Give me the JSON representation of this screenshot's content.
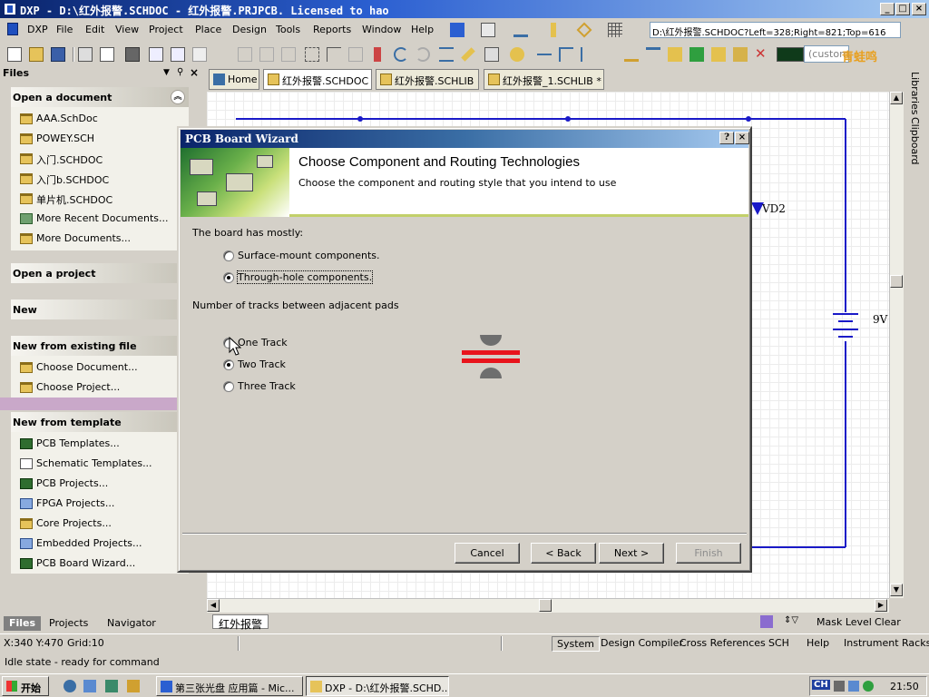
{
  "window": {
    "title": "DXP - D:\\红外报警.SCHDOC - 红外报警.PRJPCB. Licensed to hao",
    "minimize": "_",
    "maximize": "□",
    "close": "×"
  },
  "menu": {
    "items": [
      {
        "label": "DXP",
        "key": "DXP"
      },
      {
        "label": "File",
        "key": "File"
      },
      {
        "label": "Edit",
        "key": "Edit"
      },
      {
        "label": "View",
        "key": "View"
      },
      {
        "label": "Project",
        "key": "Project"
      },
      {
        "label": "Place",
        "key": "Place"
      },
      {
        "label": "Design",
        "key": "Design"
      },
      {
        "label": "Tools",
        "key": "Tools"
      },
      {
        "label": "Reports",
        "key": "Reports"
      },
      {
        "label": "Window",
        "key": "Window"
      },
      {
        "label": "Help",
        "key": "Help"
      }
    ]
  },
  "toolbar": {
    "path_value": "D:\\红外报警.SCHDOC?Left=328;Right=821;Top=616",
    "custom_value": "(custom",
    "watermark": "青蛙鸣"
  },
  "files_panel": {
    "header": "Files",
    "sections": [
      {
        "title": "Open a document",
        "items": [
          {
            "label": "AAA.SchDoc",
            "icon": "folder-icon"
          },
          {
            "label": "POWEY.SCH",
            "icon": "folder-icon"
          },
          {
            "label": "入门.SCHDOC",
            "icon": "folder-icon"
          },
          {
            "label": "入门b.SCHDOC",
            "icon": "folder-icon"
          },
          {
            "label": "单片机.SCHDOC",
            "icon": "folder-icon"
          },
          {
            "label": "More Recent Documents...",
            "icon": "folder-green-icon"
          },
          {
            "label": "More Documents...",
            "icon": "open-folder-icon"
          }
        ]
      },
      {
        "title": "Open a project",
        "items": []
      },
      {
        "title": "New",
        "items": []
      },
      {
        "title": "New from existing file",
        "items": [
          {
            "label": "Choose Document...",
            "icon": "open-folder-icon"
          },
          {
            "label": "Choose Project...",
            "icon": "open-folder-icon"
          }
        ]
      },
      {
        "title": "New from template",
        "items": [
          {
            "label": "PCB Templates...",
            "icon": "pcb-icon"
          },
          {
            "label": "Schematic Templates...",
            "icon": "schematic-icon"
          },
          {
            "label": "PCB Projects...",
            "icon": "pcb-icon"
          },
          {
            "label": "FPGA Projects...",
            "icon": "fpga-icon"
          },
          {
            "label": "Core Projects...",
            "icon": "core-icon"
          },
          {
            "label": "Embedded Projects...",
            "icon": "embedded-icon"
          },
          {
            "label": "PCB Board Wizard...",
            "icon": "pcb-icon"
          }
        ]
      }
    ],
    "bottom_tabs": [
      "Files",
      "Projects",
      "Navigator"
    ]
  },
  "doc_tabs": [
    {
      "label": "Home",
      "icon": "home-icon"
    },
    {
      "label": "红外报警.SCHDOC",
      "icon": "schdoc-icon"
    },
    {
      "label": "红外报警.SCHLIB",
      "icon": "schlib-icon"
    },
    {
      "label": "红外报警_1.SCHLIB *",
      "icon": "schlib-icon"
    }
  ],
  "schematic": {
    "labels": {
      "vd2": "VD2",
      "battery": "9V"
    }
  },
  "right_panel_tabs": [
    "Libraries",
    "Clipboard"
  ],
  "sheet_tab": "红外报警",
  "mask": {
    "mask_level": "Mask Level",
    "clear": "Clear"
  },
  "status": {
    "coords": "X:340 Y:470",
    "grid": "Grid:10",
    "idle": "Idle state - ready for command",
    "panels": [
      "System",
      "Design Compiler",
      "Cross References",
      "SCH",
      "Help",
      "Instrument Racks"
    ]
  },
  "taskbar": {
    "start": "开始",
    "tasks": [
      "第三张光盘 应用篇 - Mic...",
      "DXP - D:\\红外报警.SCHD..."
    ],
    "tray_lang": "CH",
    "clock": "21:50"
  },
  "dialog": {
    "title": "PCB Board Wizard",
    "help": "?",
    "close": "×",
    "heading": "Choose Component and Routing Technologies",
    "subheading": "Choose the component and routing style that you intend to use",
    "board_label": "The board has mostly:",
    "board_options": [
      {
        "label": "Surface-mount components.",
        "selected": false
      },
      {
        "label": "Through-hole components.",
        "selected": true
      }
    ],
    "tracks_label": "Number of tracks between adjacent pads",
    "track_options": [
      {
        "label": "One Track",
        "selected": false
      },
      {
        "label": "Two Track",
        "selected": true
      },
      {
        "label": "Three Track",
        "selected": false
      }
    ],
    "buttons": {
      "cancel": "Cancel",
      "back": "< Back",
      "next": "Next >",
      "finish": "Finish"
    },
    "colors": {
      "track": "#e8141c",
      "pad": "#6e6e6e"
    }
  }
}
